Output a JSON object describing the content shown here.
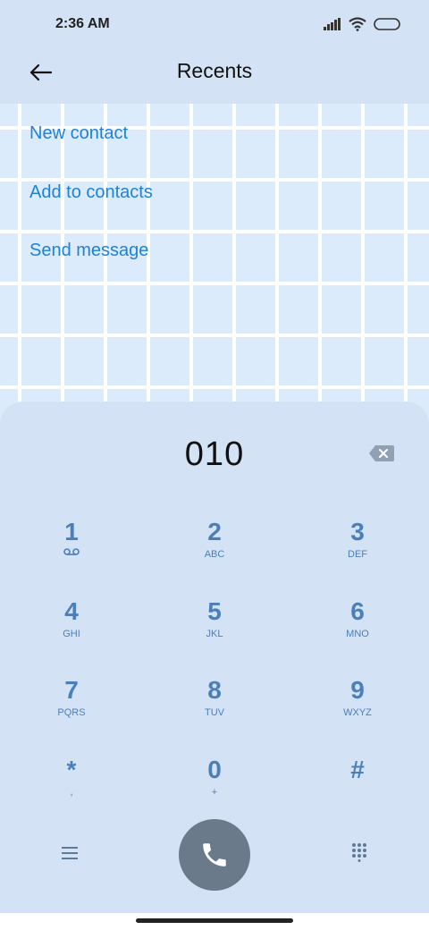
{
  "status": {
    "time": "2:36 AM"
  },
  "header": {
    "title": "Recents"
  },
  "actions": [
    {
      "label": "New contact"
    },
    {
      "label": "Add to contacts"
    },
    {
      "label": "Send message"
    }
  ],
  "dialer": {
    "number": "010",
    "keys": [
      {
        "digit": "1",
        "letters": ""
      },
      {
        "digit": "2",
        "letters": "ABC"
      },
      {
        "digit": "3",
        "letters": "DEF"
      },
      {
        "digit": "4",
        "letters": "GHI"
      },
      {
        "digit": "5",
        "letters": "JKL"
      },
      {
        "digit": "6",
        "letters": "MNO"
      },
      {
        "digit": "7",
        "letters": "PQRS"
      },
      {
        "digit": "8",
        "letters": "TUV"
      },
      {
        "digit": "9",
        "letters": "WXYZ"
      },
      {
        "digit": "*",
        "letters": ","
      },
      {
        "digit": "0",
        "letters": "+"
      },
      {
        "digit": "#",
        "letters": ""
      }
    ]
  },
  "colors": {
    "accent": "#1c82d8",
    "key_text": "#4a7fba",
    "call_button": "#6b7a8b",
    "panel": "#d3e2f4"
  },
  "icons": {
    "back": "arrow-left-icon",
    "backspace": "backspace-icon",
    "voicemail": "voicemail-icon",
    "menu": "menu-icon",
    "call": "phone-icon",
    "dialpad_toggle": "dialpad-grid-icon"
  }
}
